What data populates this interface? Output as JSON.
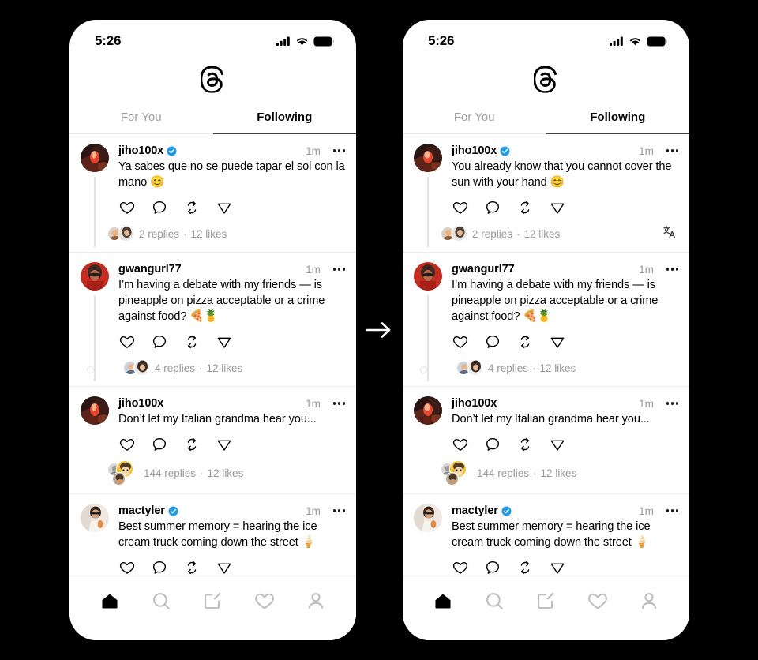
{
  "meta": {
    "app_name": "Threads",
    "flow_arrow_icon": "arrow-right-icon"
  },
  "status_bar": {
    "time": "5:26",
    "icons": [
      "cellular-signal-icon",
      "wifi-icon",
      "battery-icon"
    ]
  },
  "header": {
    "logo_icon": "threads-logo-icon",
    "tabs": [
      {
        "label": "For You",
        "active": false
      },
      {
        "label": "Following",
        "active": true
      }
    ]
  },
  "action_icons": [
    "heart-icon",
    "comment-icon",
    "repost-icon",
    "share-icon"
  ],
  "bottom_nav": [
    {
      "name": "home",
      "icon": "home-icon",
      "active": true
    },
    {
      "name": "search",
      "icon": "search-icon",
      "active": false
    },
    {
      "name": "compose",
      "icon": "compose-icon",
      "active": false
    },
    {
      "name": "activity",
      "icon": "heart-icon",
      "active": false
    },
    {
      "name": "profile",
      "icon": "profile-icon",
      "active": false
    }
  ],
  "translate": {
    "fab_icon": "translate-icon",
    "inline_icon": "translate-icon",
    "fab_label": "文A"
  },
  "left_phone": {
    "posts": [
      {
        "username": "jiho100x",
        "verified": true,
        "timestamp": "1m",
        "text": "Ya sabes que no se puede tapar el sol con la mano 😊",
        "replies": "2 replies",
        "separator": "·",
        "likes": "12 likes",
        "has_footer": true,
        "has_inline_translate": false
      },
      {
        "username": "gwangurl77",
        "verified": false,
        "timestamp": "1m",
        "text": "I’m having a debate with my friends — is pineapple on pizza acceptable or a crime against food? 🍕🍍",
        "replies": "4 replies",
        "separator": "·",
        "likes": "12 likes",
        "has_footer": true,
        "has_inline_translate": false
      },
      {
        "username": "jiho100x",
        "verified": false,
        "timestamp": "1m",
        "text": "Don’t let my Italian grandma hear you...",
        "replies": "144 replies",
        "separator": "·",
        "likes": "12 likes",
        "has_footer": true,
        "has_inline_translate": false
      },
      {
        "username": "mactyler",
        "verified": true,
        "timestamp": "1m",
        "text": "Best summer memory = hearing the ice cream truck coming down the street 🍦",
        "replies": "",
        "separator": "",
        "likes": "",
        "has_footer": false,
        "has_inline_translate": false
      }
    ]
  },
  "right_phone": {
    "posts": [
      {
        "username": "jiho100x",
        "verified": true,
        "timestamp": "1m",
        "text": "You already know that you cannot cover the sun with your hand 😊",
        "replies": "2 replies",
        "separator": "·",
        "likes": "12 likes",
        "has_footer": true,
        "has_inline_translate": true
      },
      {
        "username": "gwangurl77",
        "verified": false,
        "timestamp": "1m",
        "text": "I’m having a debate with my friends — is pineapple on pizza acceptable or a crime against food? 🍕🍍",
        "replies": "4 replies",
        "separator": "·",
        "likes": "12 likes",
        "has_footer": true,
        "has_inline_translate": false
      },
      {
        "username": "jiho100x",
        "verified": false,
        "timestamp": "1m",
        "text": "Don’t let my Italian grandma hear you...",
        "replies": "144 replies",
        "separator": "·",
        "likes": "12 likes",
        "has_footer": true,
        "has_inline_translate": false
      },
      {
        "username": "mactyler",
        "verified": true,
        "timestamp": "1m",
        "text": "Best summer memory = hearing the ice cream truck coming down the street 🍦",
        "replies": "",
        "separator": "",
        "likes": "",
        "has_footer": false,
        "has_inline_translate": false
      }
    ]
  },
  "colors": {
    "background": "#000000",
    "phone": "#ffffff",
    "verified_blue": "#1d9bf0",
    "muted_text": "#999999",
    "active_tab_underline": "#444444"
  }
}
